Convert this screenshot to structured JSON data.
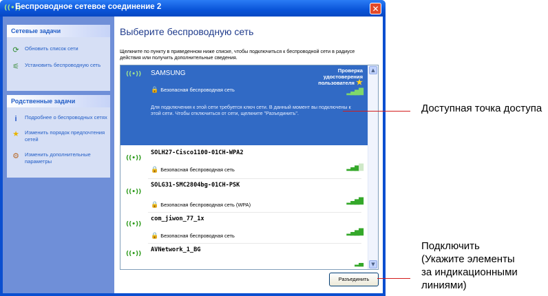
{
  "window": {
    "title": "Беспроводное сетевое соединение 2",
    "close_glyph": "✕"
  },
  "sidebar": {
    "network_tasks": {
      "heading": "Сетевые задачи",
      "items": [
        {
          "label": "Обновить список сети",
          "icon": "refresh-icon"
        },
        {
          "label": "Установить беспроводную сеть",
          "icon": "setup-icon"
        }
      ]
    },
    "related_tasks": {
      "heading": "Родственные задачи",
      "items": [
        {
          "label": "Подробнее о беспроводных сетях",
          "icon": "info-icon"
        },
        {
          "label": "Изменить порядок предпочтения сетей",
          "icon": "star-icon"
        },
        {
          "label": "Изменить дополнительные параметры",
          "icon": "settings-icon"
        }
      ]
    }
  },
  "main": {
    "title": "Выберите беспроводную сеть",
    "instructions": "Щелкните по пункту в приведенном ниже списке, чтобы подключиться к беспроводной сети в радиусе действия или получить дополнительные сведения."
  },
  "networks": [
    {
      "name": "SAMSUNG",
      "security": "Безопасная беспроводная сеть",
      "status": "Проверка удостоверения пользователя",
      "description": "Для подключения к этой сети требуется ключ сети. В данный момент вы подключены к этой сети. Чтобы отключиться от сети, щелкните \"Разъединить\".",
      "selected": true,
      "signal": 4
    },
    {
      "name": "SOLH27-Cisco1100-01CH-WPA2",
      "security": "Безопасная беспроводная сеть",
      "signal": 3
    },
    {
      "name": "SOLG31-SMC2804bg-01CH-PSK",
      "security": "Безопасная беспроводная сеть (WPA)",
      "signal": 4
    },
    {
      "name": "com_jiwon_77_1x",
      "security": "Безопасная беспроводная сеть",
      "signal": 4
    },
    {
      "name": "AVNetwork_1_BG",
      "security": "",
      "signal": 2
    }
  ],
  "buttons": {
    "disconnect": "Разъединить"
  },
  "callouts": {
    "access_point": "Доступная точка доступа",
    "connect_line1": "Подключить",
    "connect_line2": "(Укажите элементы",
    "connect_line3": "за индикационными",
    "connect_line4": "линиями)"
  },
  "colors": {
    "titlebar": "#0a54d8",
    "sidebar": "#6f8fd8",
    "selected_row": "#316ac5",
    "callout_line": "#d31a1a"
  }
}
